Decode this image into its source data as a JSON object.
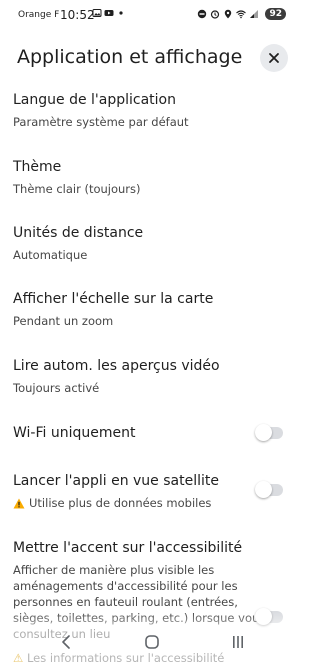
{
  "status_bar": {
    "carrier": "Orange F",
    "time": "10:52",
    "battery": "92"
  },
  "header": {
    "title": "Application et affichage"
  },
  "settings": [
    {
      "title": "Langue de l'application",
      "subtitle": "Paramètre système par défaut"
    },
    {
      "title": "Thème",
      "subtitle": "Thème clair (toujours)"
    },
    {
      "title": "Unités de distance",
      "subtitle": "Automatique"
    },
    {
      "title": "Afficher l'échelle sur la carte",
      "subtitle": "Pendant un zoom"
    },
    {
      "title": "Lire autom. les aperçus vidéo",
      "subtitle": "Toujours activé"
    },
    {
      "title": "Wi-Fi uniquement",
      "toggle": false
    },
    {
      "title": "Lancer l'appli en vue satellite",
      "subtitle": "Utilise plus de données mobiles",
      "toggle": false
    },
    {
      "title": "Mettre l'accent sur l'accessibilité",
      "description": "Afficher de manière plus visible les aménagements d'accessibilité pour les personnes en fauteuil roulant (entrées, sièges, toilettes, parking, etc.) lorsque vous consultez un lieu",
      "toggle": false
    }
  ],
  "faded_footer_text": "Les informations sur l'accessibilité",
  "colors": {
    "toggle_track": "#dadce0",
    "close_button_bg": "#e8eaed",
    "warning": "#f9ab00"
  },
  "icons": {
    "close": "close-icon",
    "warning": "warning-icon",
    "nav_back": "back-icon",
    "nav_home": "home-icon",
    "nav_recents": "recents-icon"
  }
}
